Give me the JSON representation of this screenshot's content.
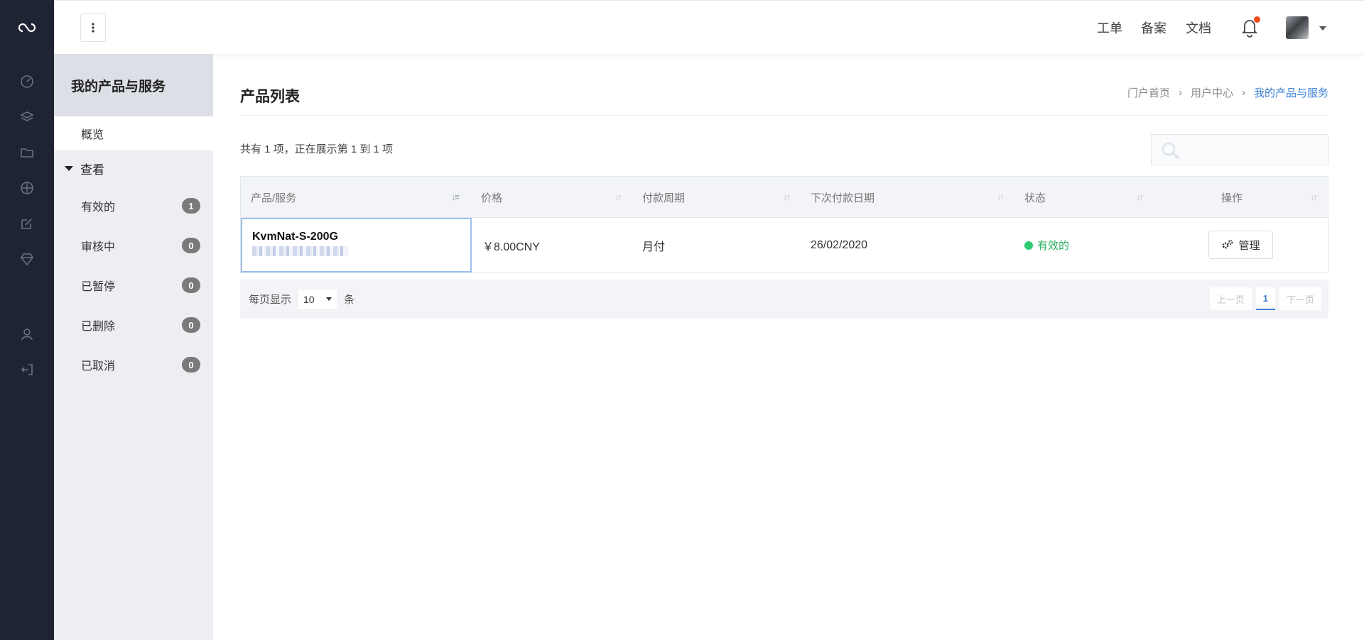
{
  "topbar": {
    "links": [
      "工单",
      "备案",
      "文档"
    ]
  },
  "sidebar_icons": [
    "cloud-logo-icon",
    "dashboard-icon",
    "layers-icon",
    "folder-icon",
    "globe-icon",
    "edit-icon",
    "diamond-icon",
    "user-icon",
    "logout-icon"
  ],
  "subnav": {
    "title": "我的产品与服务",
    "overview": "概览",
    "group_label": "查看",
    "items": [
      {
        "label": "有效的",
        "count": "1"
      },
      {
        "label": "审核中",
        "count": "0"
      },
      {
        "label": "已暂停",
        "count": "0"
      },
      {
        "label": "已删除",
        "count": "0"
      },
      {
        "label": "已取消",
        "count": "0"
      }
    ]
  },
  "main": {
    "title": "产品列表",
    "breadcrumb": [
      "门户首页",
      "用户中心",
      "我的产品与服务"
    ],
    "count_text": "共有 1 项，正在展示第 1 到 1 项",
    "search_placeholder": ""
  },
  "table": {
    "headers": [
      "产品/服务",
      "价格",
      "付款周期",
      "下次付款日期",
      "状态",
      "操作"
    ],
    "rows": [
      {
        "product": "KvmNat-S-200G",
        "price": "￥8.00CNY",
        "cycle": "月付",
        "next_due": "26/02/2020",
        "status": "有效的",
        "action": "管理"
      }
    ]
  },
  "footer": {
    "per_page_label": "每页显示",
    "per_page_value": "10",
    "per_page_unit": "条",
    "prev": "上一页",
    "page": "1",
    "next": "下一页"
  },
  "colors": {
    "rail": "#1f2433",
    "accent": "#3c7fd6",
    "status_active": "#27ae60",
    "notification": "#f44b1c"
  }
}
